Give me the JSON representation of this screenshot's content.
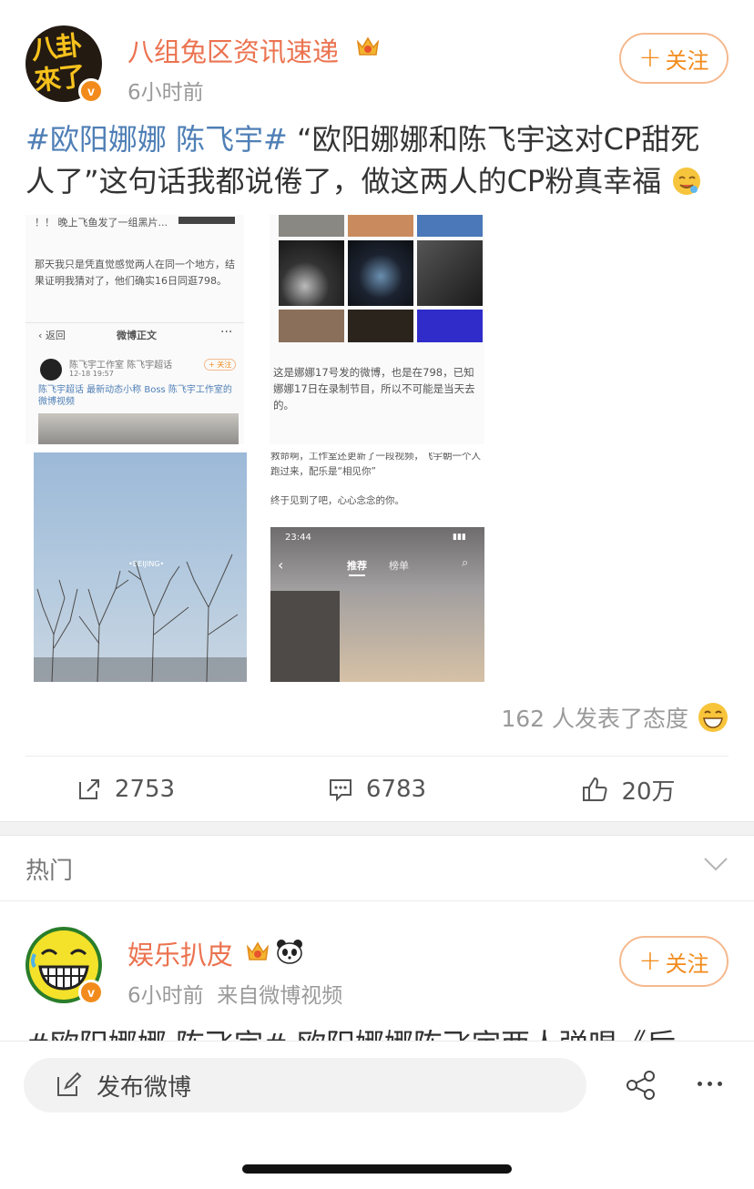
{
  "post1": {
    "avatar_text": "八卦來了",
    "username": "八组兔区资讯速递",
    "time": "6小时前",
    "follow_label": "关注",
    "topic": "#欧阳娜娜 陈飞宇#",
    "text": "“欧阳娜娜和陈飞宇这对CP甜死人了”这句话我都说倦了，做这两人的CP粉真幸福",
    "images": {
      "img1": {
        "top_line": "！！ 晚上飞鱼发了一组黑片...",
        "body": "那天我只是凭直觉感觉两人在同一个地方，结果证明我猜对了，他们确实16日同逛798。",
        "back_label": "返回",
        "nav_title": "微博正文",
        "account": "陈飞宇工作室",
        "account_tag": "陈飞宇超话",
        "account_time": "12-18 19:57",
        "follow_small": "+ 关注",
        "repost_line": "陈飞宇超话 最新动态小称 Boss 陈飞宇工作室的微博视频"
      },
      "img2": {
        "caption": "这是娜娜17号发的微博，也是在798，已知娜娜17日在录制节目，所以不可能是当天去的。"
      },
      "img3": {
        "sign": "•BEIJING•"
      },
      "img4": {
        "top_text": "救命啊，工作室还更新了一段视频，飞宇朝一个人跑过来，配乐是“相见你”",
        "line2": "终于见到了吧，心心念念的你。",
        "status_time": "23:44",
        "tab_recommend": "推荐",
        "tab_rank": "榜单"
      }
    },
    "reactions_text": "162 人发表了态度",
    "repost_count": "2753",
    "comment_count": "6783",
    "like_count": "20万"
  },
  "hot_label": "热门",
  "post2": {
    "username": "娱乐扒皮",
    "time": "6小时前",
    "source": "来自微博视频",
    "follow_label": "关注",
    "cut_text": "#欧阳娜娜 陈飞宇# 欧阳娜娜陈飞宇两人弹唱《后"
  },
  "bottom": {
    "compose_label": "发布微博"
  },
  "colors": {
    "orange": "#f28b1c",
    "username": "#eb7350",
    "topic_blue": "#4f7fb6"
  }
}
